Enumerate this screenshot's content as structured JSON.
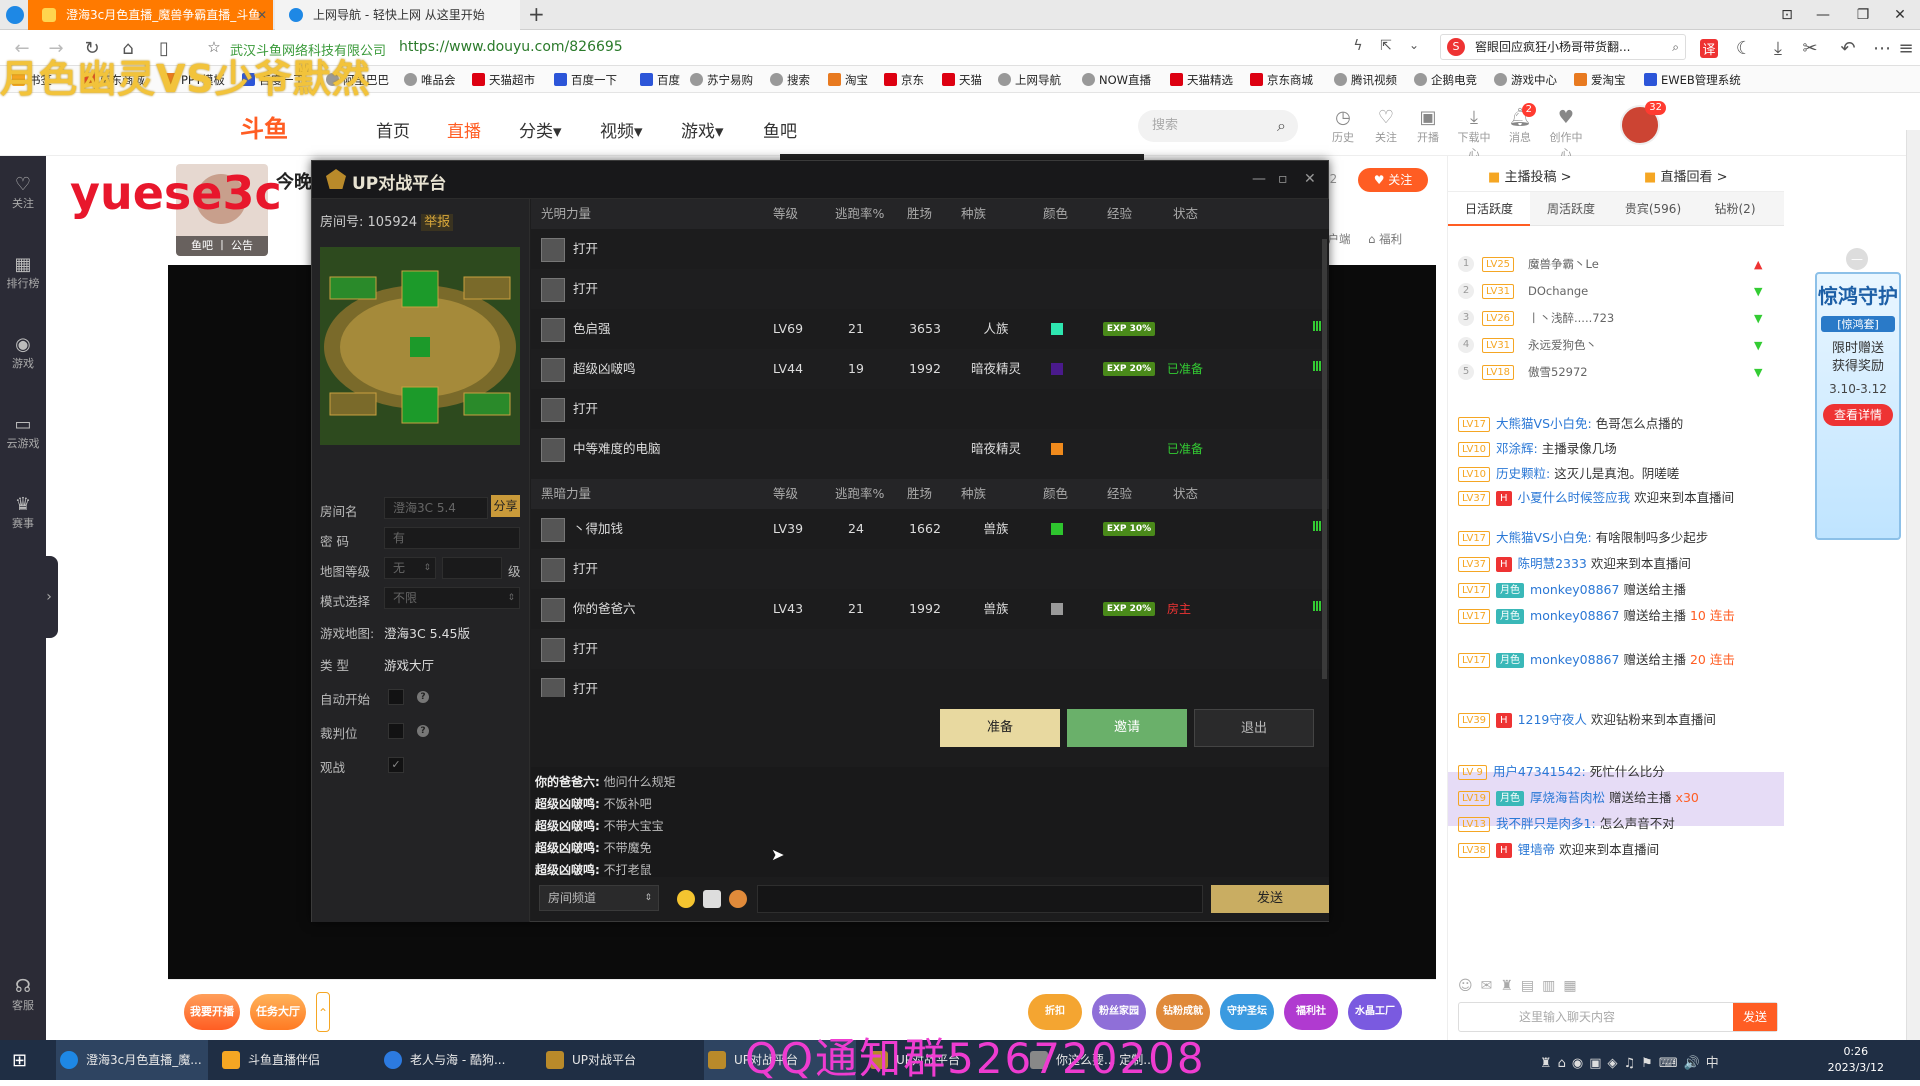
{
  "browser": {
    "tabs": [
      {
        "title": "澄海3c月色直播_魔兽争霸直播_斗鱼"
      },
      {
        "title": "上网导航 - 轻快上网 从这里开始"
      }
    ],
    "company": "武汉斗鱼网络科技有限公司",
    "url": "https://www.douyu.com/826695",
    "search_text": "窖眼回应疯狂小杨哥带货翻..."
  },
  "bookmarks": [
    "书签",
    "京东商城",
    "PPT模板",
    "百度一下",
    "阿里巴巴",
    "唯品会",
    "天猫超市",
    "百度一下",
    "百度",
    "苏宁易购",
    "搜索",
    "淘宝",
    "京东",
    "天猫",
    "上网导航",
    "NOW直播",
    "天猫精选",
    "京东商城",
    "腾讯视频",
    "企鹅电竞",
    "游戏中心",
    "爱淘宝",
    "EWEB管理系统"
  ],
  "overlays": {
    "top": "月色幽灵VS少爷默然",
    "left": "yuese3c",
    "bottom": "QQ通知群526720208"
  },
  "douyu": {
    "nav": [
      "首页",
      "直播",
      "分类",
      "视频",
      "游戏",
      "鱼吧"
    ],
    "search_placeholder": "搜索",
    "header_icons": [
      {
        "icon": "history-icon",
        "label": "历史"
      },
      {
        "icon": "heart-icon",
        "label": "关注"
      },
      {
        "icon": "broadcast-icon",
        "label": "开播"
      },
      {
        "icon": "download-icon",
        "label": "下载中心"
      },
      {
        "icon": "bell-icon",
        "label": "消息",
        "badge": "2"
      },
      {
        "icon": "creator-icon",
        "label": "创作中心"
      }
    ],
    "avatar_badge": "32",
    "left_items": [
      {
        "icon": "follow-icon",
        "label": "关注"
      },
      {
        "icon": "rank-icon",
        "label": "排行榜"
      },
      {
        "icon": "game-icon",
        "label": "游戏"
      },
      {
        "icon": "cloud-game-icon",
        "label": "云游戏"
      },
      {
        "icon": "trophy-icon",
        "label": "赛事"
      },
      {
        "icon": "service-icon",
        "label": "客服"
      }
    ],
    "streamer_tag": "鱼吧 丨 公告",
    "stream_title": "今晚",
    "follow_label": "关注",
    "follow_count": "52",
    "video_tools": [
      "客户端",
      "福利"
    ],
    "bottom_buttons": [
      "我要开播",
      "任务大厅"
    ],
    "bottom_icons": [
      "折扣",
      "粉丝家园",
      "钻粉成就",
      "守护圣坛",
      "福利社",
      "水晶工厂"
    ]
  },
  "up": {
    "title": "UP对战平台",
    "room_label": "房间号:",
    "room_no": "105924",
    "report": "举报",
    "fields": {
      "room_name_label": "房间名",
      "room_name": "澄海3C 5.4",
      "share": "分享",
      "password_label": "密 码",
      "password": "有",
      "level_label": "地图等级",
      "level_value": "无",
      "level_unit": "级",
      "mode_label": "模式选择",
      "mode_value": "不限",
      "map_label": "游戏地图:",
      "map_value": "澄海3C 5.45版",
      "type_label": "类 型",
      "type_value": "游戏大厅",
      "auto_label": "自动开始",
      "judge_label": "裁判位",
      "watch_label": "观战"
    },
    "headers": {
      "light": "光明力量",
      "dark": "黑暗力量",
      "level": "等级",
      "escape": "逃跑率%",
      "wins": "胜场",
      "race": "种族",
      "color": "颜色",
      "exp": "经验",
      "status": "状态"
    },
    "light_rows": [
      {
        "name": "打开",
        "level": "",
        "escape": "",
        "wins": "",
        "race": "",
        "color": "",
        "exp": "",
        "status": ""
      },
      {
        "name": "打开",
        "level": "",
        "escape": "",
        "wins": "",
        "race": "",
        "color": "",
        "exp": "",
        "status": ""
      },
      {
        "name": "色启强",
        "level": "LV69",
        "escape": "21",
        "wins": "3653",
        "race": "人族",
        "color": "#2ee6b0",
        "exp": "EXP 30%",
        "status": ""
      },
      {
        "name": "超级凶啵鸣",
        "level": "LV44",
        "escape": "19",
        "wins": "1992",
        "race": "暗夜精灵",
        "color": "#4a1a8c",
        "exp": "EXP 20%",
        "status": "已准备"
      },
      {
        "name": "打开",
        "level": "",
        "escape": "",
        "wins": "",
        "race": "",
        "color": "",
        "exp": "",
        "status": ""
      },
      {
        "name": "中等难度的电脑",
        "level": "",
        "escape": "",
        "wins": "",
        "race": "暗夜精灵",
        "color": "#f08a1c",
        "exp": "",
        "status": "已准备"
      }
    ],
    "dark_rows": [
      {
        "name": "丶得加钱",
        "level": "LV39",
        "escape": "24",
        "wins": "1662",
        "race": "兽族",
        "color": "#2ec52e",
        "exp": "EXP 10%",
        "status": ""
      },
      {
        "name": "打开",
        "level": "",
        "escape": "",
        "wins": "",
        "race": "",
        "color": "",
        "exp": "",
        "status": ""
      },
      {
        "name": "你的爸爸六",
        "level": "LV43",
        "escape": "21",
        "wins": "1992",
        "race": "兽族",
        "color": "#9a9a9a",
        "exp": "EXP 20%",
        "status": "房主"
      },
      {
        "name": "打开",
        "level": "",
        "escape": "",
        "wins": "",
        "race": "",
        "color": "",
        "exp": "",
        "status": ""
      },
      {
        "name": "打开",
        "level": "",
        "escape": "",
        "wins": "",
        "race": "",
        "color": "",
        "exp": "",
        "status": ""
      }
    ],
    "buttons": {
      "ready": "准备",
      "invite": "邀请",
      "exit": "退出"
    },
    "chat": [
      {
        "user": "你的爸爸六:",
        "text": "他问什么规矩"
      },
      {
        "user": "超级凶啵鸣:",
        "text": "不饭补吧"
      },
      {
        "user": "超级凶啵鸣:",
        "text": "不带大宝宝"
      },
      {
        "user": "超级凶啵鸣:",
        "text": "不带魔免"
      },
      {
        "user": "超级凶啵鸣:",
        "text": "不打老鼠"
      }
    ],
    "channel": "房间频道",
    "send": "发送"
  },
  "rpanel": {
    "top_tabs": [
      "主播投稿 >",
      "直播回看 >"
    ],
    "tabs": [
      "日活跃度",
      "周活跃度",
      "贵宾(596)",
      "钻粉(2)"
    ],
    "ranks": [
      {
        "n": "1",
        "lv": "LV25",
        "user": "魔兽争霸丶Le",
        "arrow": "up"
      },
      {
        "n": "2",
        "lv": "LV31",
        "user": "DOchange",
        "arrow": "down"
      },
      {
        "n": "3",
        "lv": "LV26",
        "user": "丨丶浅醉.....723",
        "arrow": "down"
      },
      {
        "n": "4",
        "lv": "LV31",
        "user": "永远爱狗色丶",
        "arrow": "down"
      },
      {
        "n": "5",
        "lv": "LV18",
        "user": "傲雪52972",
        "arrow": "down"
      }
    ],
    "messages": [
      {
        "lv": "LV17",
        "badge": "",
        "user": "大熊猫VS小白免:",
        "text": "色哥怎么点播的",
        "gift": ""
      },
      {
        "lv": "LV10",
        "badge": "",
        "user": "邓涂辉:",
        "text": "主播录像几场",
        "gift": ""
      },
      {
        "lv": "LV10",
        "badge": "",
        "user": "历史颗粒:",
        "text": "这灭儿是真泡。阴嗟嗟",
        "gift": ""
      },
      {
        "lv": "LV37",
        "badge": "H",
        "user": "小夏什么时候签应我",
        "text": "欢迎来到本直播间",
        "gift": ""
      },
      {
        "lv": "LV17",
        "badge": "",
        "user": "大熊猫VS小白免:",
        "text": "有啥限制吗多少起步",
        "gift": ""
      },
      {
        "lv": "LV37",
        "badge": "H",
        "user": "陈明慧2333",
        "text": "欢迎来到本直播间",
        "gift": ""
      },
      {
        "lv": "LV17",
        "badge": "月色",
        "user": "monkey08867",
        "text": "赠送给主播",
        "gift": ""
      },
      {
        "lv": "LV17",
        "badge": "月色",
        "user": "monkey08867",
        "text": "赠送给主播",
        "gift": "10 连击"
      },
      {
        "lv": "LV17",
        "badge": "月色",
        "user": "monkey08867",
        "text": "赠送给主播",
        "gift": "20 连击"
      },
      {
        "lv": "LV39",
        "badge": "H",
        "user": "1219守夜人",
        "text": "欢迎钻粉来到本直播间",
        "gift": ""
      },
      {
        "lv": "LV 9",
        "badge": "",
        "user": "用户47341542:",
        "text": "死忙什么比分",
        "gift": ""
      },
      {
        "lv": "LV19",
        "badge": "月色",
        "user": "厚烧海苔肉松",
        "text": "赠送给主播",
        "gift": "x30"
      },
      {
        "lv": "LV13",
        "badge": "",
        "user": "我不胖只是肉多1:",
        "text": "怎么声音不对",
        "gift": ""
      },
      {
        "lv": "LV38",
        "badge": "H",
        "user": "锂墙帝",
        "text": "欢迎来到本直播间",
        "gift": ""
      }
    ],
    "input_placeholder": "这里输入聊天内容",
    "send": "发送"
  },
  "ad": {
    "title": "惊鸿守护",
    "tag": "[惊鸿套]",
    "line1": "限时赠送",
    "line2": "获得奖励",
    "dates": "3.10-3.12",
    "cta": "查看详情"
  },
  "taskbar": {
    "items": [
      "澄海3c月色直播_魔...",
      "斗鱼直播伴侣",
      "老人与海 - 酷狗...",
      "UP对战平台",
      "UP对战平台",
      "UP对战平台",
      "你这么要...",
      "定制..."
    ],
    "time": "0:26",
    "date": "2023/3/12"
  }
}
